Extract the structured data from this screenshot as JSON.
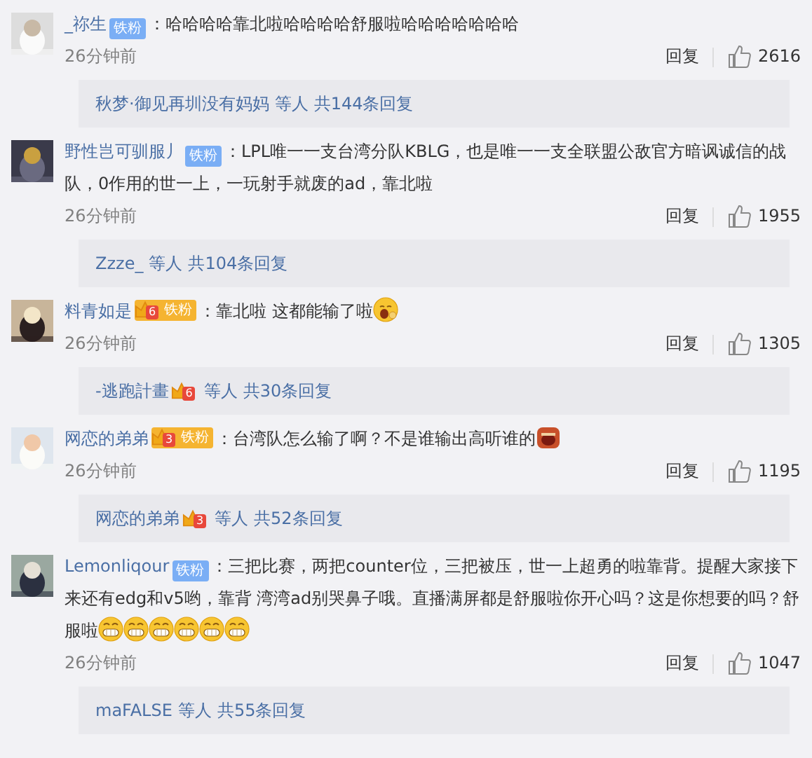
{
  "comments": [
    {
      "user": "_祢生",
      "badge": {
        "kind": "blue",
        "label": "铁粉"
      },
      "text": "：哈哈哈哈靠北啦哈哈哈哈舒服啦哈哈哈哈哈哈哈",
      "time": "26分钟前",
      "reply_label": "回复",
      "likes": "2616",
      "replies": {
        "users": [
          {
            "name": "秋梦·御见再圳没有妈妈"
          }
        ],
        "others": "等人",
        "total": "共144条回复"
      }
    },
    {
      "user": "野性岂可驯服丿",
      "badge": {
        "kind": "blue",
        "label": "铁粉"
      },
      "text": "：LPL唯一一支台湾分队KBLG，也是唯一一支全联盟公敌官方暗讽诚信的战队，0作用的世一上，一玩射手就废的ad，靠北啦",
      "time": "26分钟前",
      "reply_label": "回复",
      "likes": "1955",
      "replies": {
        "users": [
          {
            "name": "Zzze_"
          }
        ],
        "others": "等人",
        "total": "共104条回复"
      }
    },
    {
      "user": "料青如是",
      "badge": {
        "kind": "crown",
        "level": "6",
        "label": "铁粉"
      },
      "text": "：靠北啦 这都能输了啦",
      "emojis": [
        {
          "kind": "yawn"
        }
      ],
      "time": "26分钟前",
      "reply_label": "回复",
      "likes": "1305",
      "replies": {
        "users": [
          {
            "name": "-逃跑計畫",
            "badge": {
              "kind": "crown",
              "level": "6"
            }
          }
        ],
        "others": "等人",
        "total": "共30条回复"
      }
    },
    {
      "user": "网恋的弟弟",
      "badge": {
        "kind": "crown",
        "level": "3",
        "label": "铁粉"
      },
      "text": "：台湾队怎么输了啊？不是谁输出高听谁的",
      "emojis": [
        {
          "kind": "shout"
        }
      ],
      "time": "26分钟前",
      "reply_label": "回复",
      "likes": "1195",
      "replies": {
        "users": [
          {
            "name": "网恋的弟弟",
            "badge": {
              "kind": "crown",
              "level": "3"
            }
          }
        ],
        "others": "等人",
        "total": "共52条回复"
      }
    },
    {
      "user": "Lemonliqour",
      "badge": {
        "kind": "blue",
        "label": "铁粉"
      },
      "text": "：三把比赛，两把counter位，三把被压，世一上超勇的啦靠背。提醒大家接下来还有edg和v5哟，靠背 湾湾ad别哭鼻子哦。直播满屏都是舒服啦你开心吗？这是你想要的吗？舒服啦",
      "emojis": [
        {
          "kind": "grin"
        },
        {
          "kind": "grin"
        },
        {
          "kind": "grin"
        },
        {
          "kind": "grin"
        },
        {
          "kind": "grin"
        },
        {
          "kind": "grin"
        }
      ],
      "time": "26分钟前",
      "reply_label": "回复",
      "likes": "1047",
      "replies": {
        "users": [
          {
            "name": "maFALSE"
          }
        ],
        "others": "等人",
        "total": "共55条回复"
      }
    }
  ]
}
